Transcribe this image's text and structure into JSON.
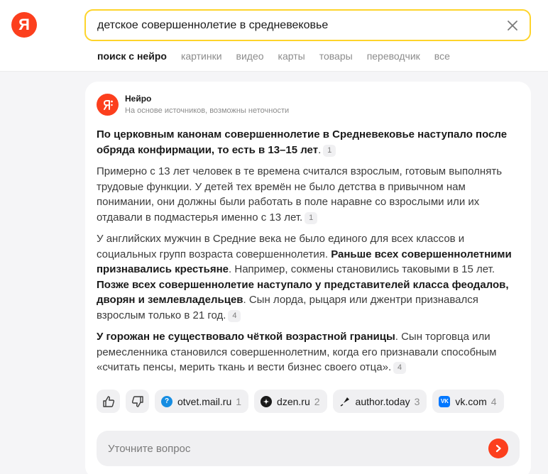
{
  "logo": {
    "letter": "Я",
    "color": "#fc3f1d"
  },
  "search": {
    "value": "детское совершеннолетие в средневековье",
    "border_color": "#fed42b"
  },
  "tabs": [
    {
      "label": "поиск с нейро",
      "active": true
    },
    {
      "label": "картинки"
    },
    {
      "label": "видео"
    },
    {
      "label": "карты"
    },
    {
      "label": "товары"
    },
    {
      "label": "переводчик"
    },
    {
      "label": "все"
    }
  ],
  "neuro": {
    "title": "Нейро",
    "subtitle": "На основе источников, возможны неточности"
  },
  "answer": {
    "p1": {
      "bold": "По церковным канонам совершеннолетие в Средневековье наступало после обряда конфирмации, то есть в 13–15 лет",
      "tail": ".",
      "ref": "1"
    },
    "p2": {
      "text": "Примерно с 13 лет человек в те времена считался взрослым, готовым выполнять трудовые функции. У детей тех времён не было детства в привычном нам понимании, они должны были работать в поле наравне со взрослыми или их отдавали в подмастерья именно с 13 лет.",
      "ref": "1"
    },
    "p3": {
      "t1": "У английских мужчин в Средние века не было единого для всех классов и социальных групп возраста совершеннолетия. ",
      "b1": "Раньше всех совершеннолетними признавались крестьяне",
      "t2": ". Например, сокмены становились таковыми в 15 лет. ",
      "b2": "Позже всех совершеннолетие наступало у представителей класса феодалов, дворян и землевладельцев",
      "t3": ". Сын лорда, рыцаря или джентри признавался взрослым только в 21 год.",
      "ref": "4"
    },
    "p4": {
      "b1": "У горожан не существовало чёткой возрастной границы",
      "t1": ". Сын торговца или ремесленника становился совершеннолетним, когда его признавали способным «считать пенсы, мерить ткань и вести бизнес своего отца».",
      "ref": "4"
    }
  },
  "sources": [
    {
      "label": "otvet.mail.ru",
      "num": "1",
      "icon": "mail-ru-icon",
      "color": "#168de2"
    },
    {
      "label": "dzen.ru",
      "num": "2",
      "icon": "dzen-icon",
      "color": "#1a1a1a"
    },
    {
      "label": "author.today",
      "num": "3",
      "icon": "pen-icon",
      "color": "#1a1a1a"
    },
    {
      "label": "vk.com",
      "num": "4",
      "icon": "vk-icon",
      "color": "#0077ff"
    }
  ],
  "followup": {
    "placeholder": "Уточните вопрос"
  }
}
